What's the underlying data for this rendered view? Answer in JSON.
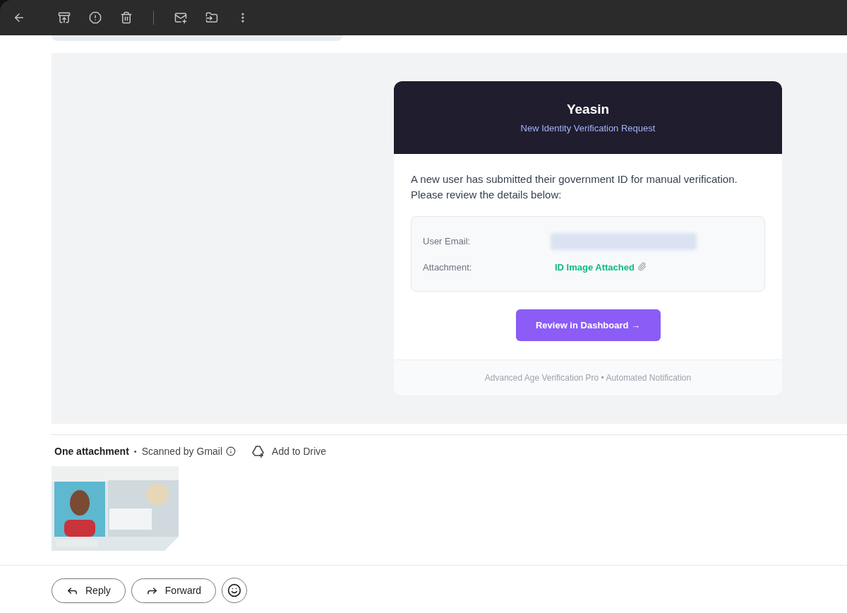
{
  "toolbar": {
    "buttons": [
      {
        "kind": "back"
      },
      {
        "kind": "archive"
      },
      {
        "kind": "spam"
      },
      {
        "kind": "delete"
      },
      {
        "kind": "divider"
      },
      {
        "kind": "unread"
      },
      {
        "kind": "move"
      },
      {
        "kind": "more"
      }
    ]
  },
  "email": {
    "brand": "Yeasin",
    "subtitle": "New Identity Verification Request",
    "intro": "A new user has submitted their government ID for manual verification. Please review the details below:",
    "details": [
      {
        "kind": "redacted",
        "label": "User Email:"
      },
      {
        "kind": "attachment",
        "label": "Attachment:",
        "value": "ID Image Attached"
      }
    ],
    "button": "Review in Dashboard →",
    "footer": "Advanced Age Verification Pro • Automated Notification"
  },
  "attachments": {
    "title": "One attachment",
    "separator": "•",
    "scanned": "Scanned by Gmail",
    "add_to_drive": "Add to Drive"
  },
  "actions": [
    {
      "kind": "reply",
      "label": "Reply"
    },
    {
      "kind": "forward",
      "label": "Forward"
    },
    {
      "kind": "emoji"
    }
  ]
}
